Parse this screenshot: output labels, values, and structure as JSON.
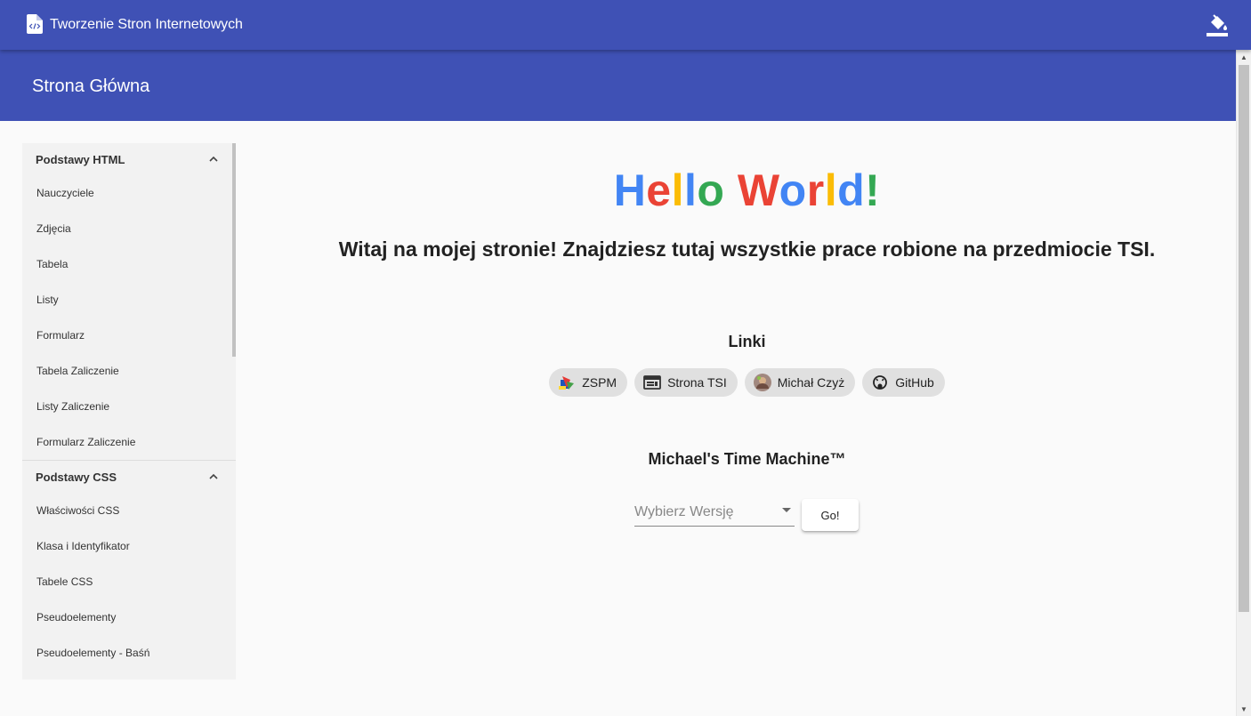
{
  "app": {
    "title": "Tworzenie Stron Internetowych"
  },
  "header": {
    "title": "Strona Główna"
  },
  "sidebar": {
    "groups": [
      {
        "title": "Podstawy HTML",
        "items": [
          "Nauczyciele",
          "Zdjęcia",
          "Tabela",
          "Listy",
          "Formularz",
          "Tabela Zaliczenie",
          "Listy Zaliczenie",
          "Formularz Zaliczenie"
        ]
      },
      {
        "title": "Podstawy CSS",
        "items": [
          "Właściwości CSS",
          "Klasa i Identyfikator",
          "Tabele CSS",
          "Pseudoelementy",
          "Pseudoelementy - Baśń"
        ]
      }
    ]
  },
  "main": {
    "hello": "Hello World!",
    "hello_colors": [
      "#4285f4",
      "#ea4335",
      "#fbbc05",
      "#4285f4",
      "#34a853",
      "#ffffff",
      "#ea4335",
      "#4285f4",
      "#ea4335",
      "#fbbc05",
      "#4285f4",
      "#34a853"
    ],
    "welcome": "Witaj na mojej stronie! Znajdziesz tutaj wszystkie prace robione na przedmiocie TSI.",
    "links_title": "Linki",
    "chips": [
      {
        "label": "ZSPM",
        "icon": "school-logo-icon"
      },
      {
        "label": "Strona TSI",
        "icon": "web-icon"
      },
      {
        "label": "Michał Czyż",
        "icon": "avatar-icon"
      },
      {
        "label": "GitHub",
        "icon": "github-icon"
      }
    ],
    "time_machine": {
      "title": "Michael's Time Machine™",
      "placeholder": "Wybierz Wersję",
      "button": "Go!"
    }
  },
  "colors": {
    "primary": "#3f51b5",
    "background": "#fafafa",
    "sidebar": "#f2f2f2"
  }
}
